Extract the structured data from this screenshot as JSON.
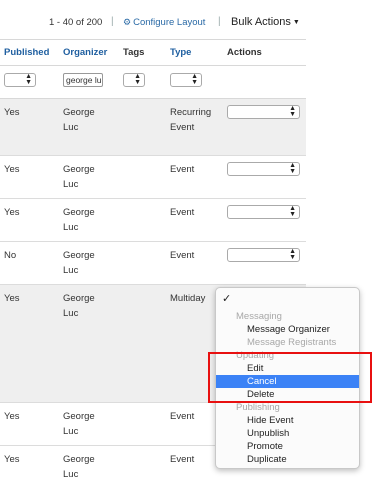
{
  "topbar": {
    "pager": "1 - 40 of 200",
    "separator": "|",
    "configure_label": "Configure Layout",
    "bulk_label": "Bulk Actions"
  },
  "columns": {
    "published": "Published",
    "organizer": "Organizer",
    "tags": "Tags",
    "type": "Type",
    "actions": "Actions"
  },
  "filters": {
    "organizer_value": "george lu"
  },
  "rows": [
    {
      "published": "Yes",
      "organizer1": "George",
      "organizer2": "Luc",
      "type1": "Recurring",
      "type2": "Event"
    },
    {
      "published": "Yes",
      "organizer1": "George",
      "organizer2": "Luc",
      "type1": "Event",
      "type2": ""
    },
    {
      "published": "Yes",
      "organizer1": "George",
      "organizer2": "Luc",
      "type1": "Event",
      "type2": ""
    },
    {
      "published": "No",
      "organizer1": "George",
      "organizer2": "Luc",
      "type1": "Event",
      "type2": ""
    },
    {
      "published": "Yes",
      "organizer1": "George",
      "organizer2": "Luc",
      "type1": "Multiday",
      "type2": ""
    },
    {
      "published": "Yes",
      "organizer1": "George",
      "organizer2": "Luc",
      "type1": "Event",
      "type2": ""
    },
    {
      "published": "Yes",
      "organizer1": "George",
      "organizer2": "Luc",
      "type1": "Event",
      "type2": ""
    }
  ],
  "menu": {
    "checkmark": "✓",
    "group_messaging": "Messaging",
    "message_organizer": "Message Organizer",
    "message_registrants": "Message Registrants",
    "group_updating": "Updating",
    "edit": "Edit",
    "cancel": "Cancel",
    "delete": "Delete",
    "group_publishing": "Publishing",
    "hide_event": "Hide Event",
    "unpublish": "Unpublish",
    "promote": "Promote",
    "duplicate": "Duplicate"
  },
  "colors": {
    "link": "#2a6aa6",
    "header": "#1f5fa0",
    "selection": "#3b82f6",
    "highlight": "#e81010"
  }
}
